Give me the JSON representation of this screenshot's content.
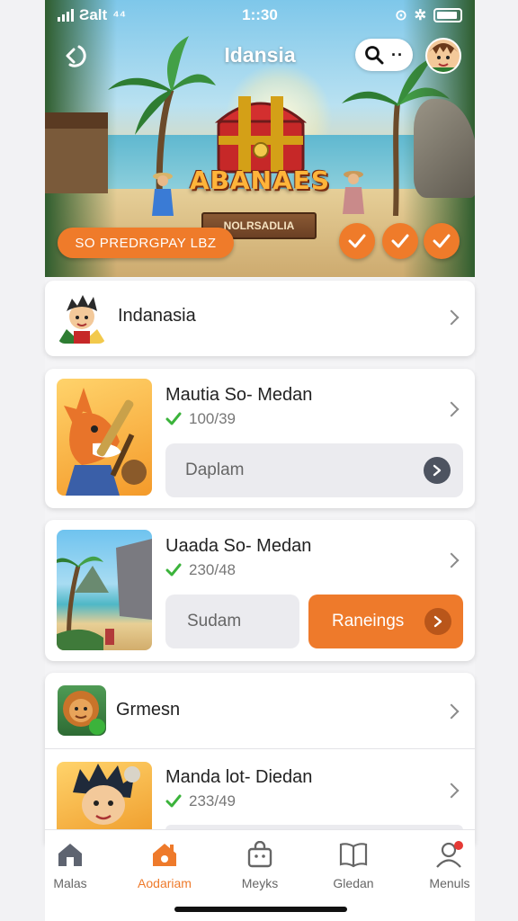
{
  "status_bar": {
    "carrier": "Ƨalt",
    "time": "1::30",
    "icons": [
      "signal-icon",
      "network-icon",
      "alarm-icon",
      "rotation-icon",
      "battery-icon"
    ]
  },
  "header": {
    "title": "Idansia",
    "back_icon": "back-arrow-icon",
    "search_icon": "search-icon",
    "more_icon": "more-icon"
  },
  "hero": {
    "game_logo": "ABANAES",
    "sign_text": "NOLRSADLIA",
    "promo_label": "SO PREDRGPAY LBZ",
    "check_buttons": 3
  },
  "list": [
    {
      "title": "Indanasia"
    },
    {
      "title": "Mautia So- Medan",
      "count": "100/39",
      "action_label": "Daplam"
    },
    {
      "title": "Uaada So- Medan",
      "count": "230/48",
      "secondary_label": "Sudam",
      "primary_label": "Raneings"
    },
    {
      "title": "Grmesn"
    },
    {
      "title": "Manda lot- Diedan",
      "count": "233/49"
    }
  ],
  "bottom_nav": [
    {
      "label": "Malas",
      "icon": "home-icon",
      "active": false
    },
    {
      "label": "Aodariam",
      "icon": "house-icon",
      "active": true
    },
    {
      "label": "Meyks",
      "icon": "bag-icon",
      "active": false
    },
    {
      "label": "Gledan",
      "icon": "book-icon",
      "active": false
    },
    {
      "label": "Menuls",
      "icon": "profile-icon",
      "active": false,
      "badge": true
    }
  ],
  "colors": {
    "accent": "#ee7a2b",
    "check_green": "#3bb33b"
  }
}
